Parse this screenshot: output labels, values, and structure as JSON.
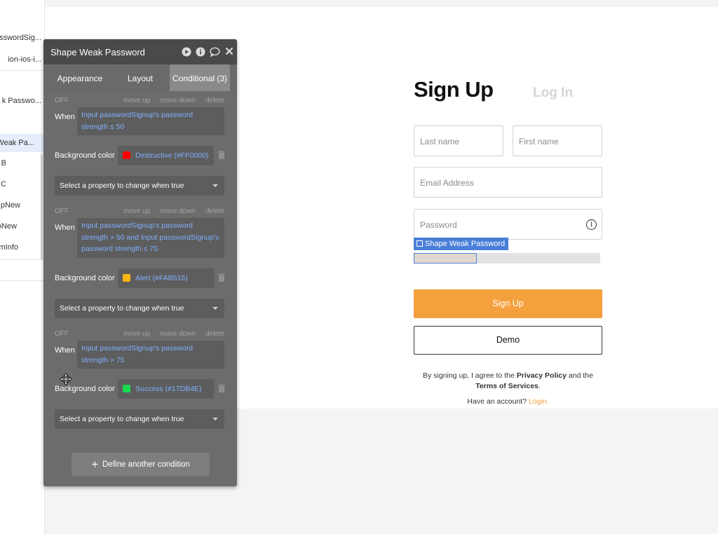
{
  "tree": {
    "items": [
      {
        "label": "asswordSig...",
        "selected": false
      },
      {
        "label": "ion-ios-i...",
        "selected": false
      },
      {
        "label": "k Passwo...",
        "selected": false
      },
      {
        "label": "Weak Pa...",
        "selected": true
      },
      {
        "label": "B",
        "selected": false
      },
      {
        "label": "C",
        "selected": false
      },
      {
        "label": "UpNew",
        "selected": false
      },
      {
        "label": "oNew",
        "selected": false
      },
      {
        "label": "mInfo",
        "selected": false
      }
    ]
  },
  "panel": {
    "title": "Shape Weak Password",
    "tabs": [
      "Appearance",
      "Layout",
      "Conditional (3)"
    ],
    "active_tab": "Conditional (3)",
    "labels": {
      "off": "OFF",
      "move_up": "move up",
      "move_down": "move down",
      "delete": "delete",
      "when": "When",
      "background_color": "Background color",
      "select_property": "Select a property to change when true"
    },
    "conditions": [
      {
        "expression": "Input passwordSignup's password strength ≤ 50",
        "color_label": "Destructive (#FF0000)",
        "swatch": "#ff0000"
      },
      {
        "expression": "Input passwordSignup's password strength > 50 and Input passwordSignup's password strength ≤ 75",
        "color_label": "Alert (#FAB515)",
        "swatch": "#fab515"
      },
      {
        "expression": "Input passwordSignup's password strength > 75",
        "color_label": "Success (#17DB4E)",
        "swatch": "#17db4e"
      }
    ],
    "define_button": "Define another condition"
  },
  "form": {
    "title": "Sign Up",
    "login_tab": "Log In",
    "last_name_placeholder": "Last name",
    "first_name_placeholder": "First name",
    "email_placeholder": "Email Address",
    "password_placeholder": "Password",
    "info_glyph": "i",
    "selection_badge": "Shape Weak Password",
    "signup_button": "Sign Up",
    "demo_button": "Demo",
    "terms_prefix": "By signing up, I agree to the ",
    "privacy_policy": "Privacy Policy",
    "terms_and": " and the",
    "terms_of_services": "Terms of Services",
    "terms_suffix": ".",
    "have_account": "Have an account? ",
    "login_link": "Login."
  },
  "colors": {
    "accent_orange": "#f4a03c",
    "selection_blue": "#4a7fd9",
    "expression_blue": "#7fb0ff"
  }
}
